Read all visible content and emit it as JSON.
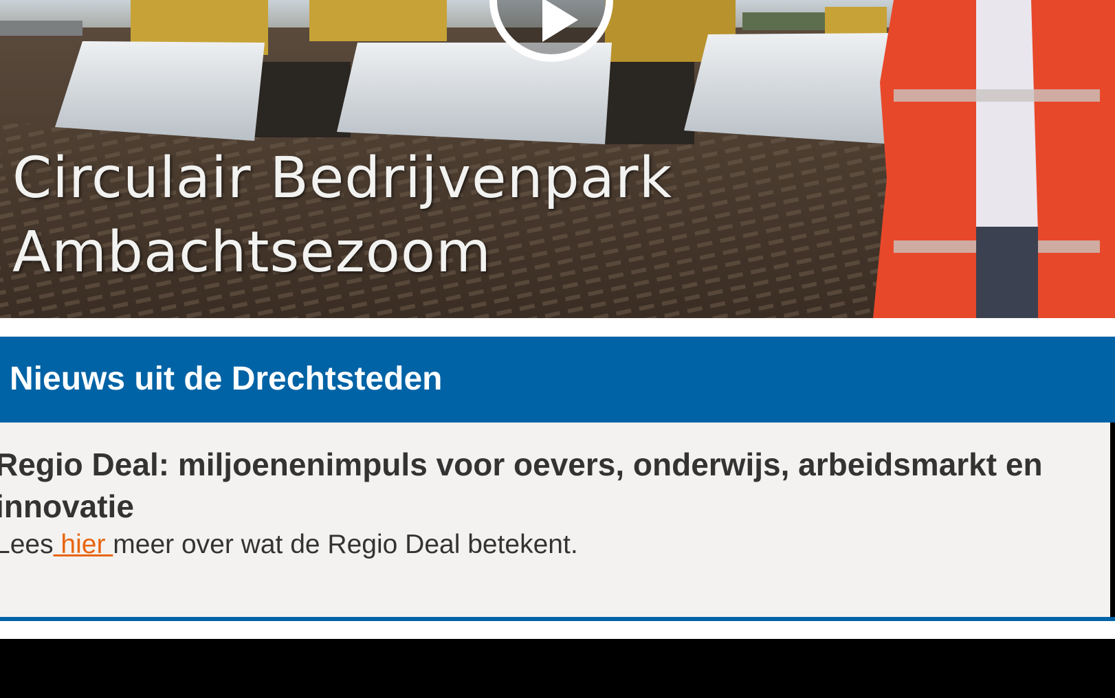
{
  "hero": {
    "title_line1": "Circulair Bedrijvenpark",
    "title_line2": "Ambachtsezoom",
    "play_icon": "play-icon"
  },
  "news_section": {
    "heading": "Nieuws uit de Drechtsteden"
  },
  "article": {
    "title": "Regio Deal: miljoenenimpuls voor oevers, onderwijs, arbeidsmarkt en innovatie",
    "body_prefix": "Lees",
    "link_text": " hier ",
    "body_suffix": "meer over wat de Regio Deal betekent."
  },
  "colors": {
    "header_blue": "#0063a6",
    "link_orange": "#e8650f",
    "article_bg": "#f4f2f0",
    "text_dark": "#333333"
  }
}
